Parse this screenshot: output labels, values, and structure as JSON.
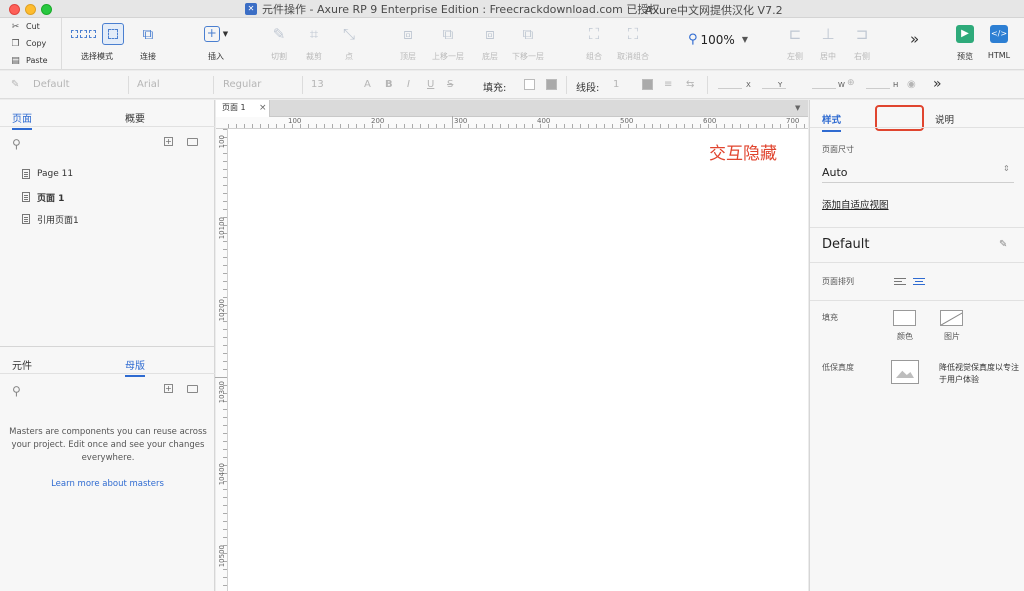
{
  "window": {
    "title": "元件操作 - Axure RP 9 Enterprise Edition : Freecrackdownload.com 已授权",
    "title_extra": "Axure中文网提供汉化 V7.2"
  },
  "clipboard": {
    "cut": "Cut",
    "copy": "Copy",
    "paste": "Paste"
  },
  "toolbar": {
    "select_mode": "选择模式",
    "connect": "连接",
    "insert": "插入",
    "cut": "切割",
    "crop": "裁剪",
    "point": "点",
    "top": "顶层",
    "up": "上移一层",
    "bottom": "底层",
    "down": "下移一层",
    "group": "组合",
    "ungroup": "取消组合",
    "zoom": "100%",
    "left": "左侧",
    "center": "居中",
    "right": "右侧",
    "more": "»",
    "preview": "预览",
    "html": "HTML"
  },
  "formatbar": {
    "style": "Default",
    "font": "Arial",
    "weight": "Regular",
    "size": "13",
    "font_a": "A",
    "bold": "B",
    "italic": "I",
    "underline": "U",
    "strike": "S",
    "fill": "填充:",
    "stroke": "线段:",
    "stroke_width": "1",
    "x_label": "X",
    "y_label": "Y",
    "w_label": "W",
    "h_label": "H",
    "more": "»"
  },
  "left_panel": {
    "top_tabs": [
      "页面",
      "概要"
    ],
    "pages": [
      {
        "name": "Page 11",
        "bold": false
      },
      {
        "name": "页面 1",
        "bold": true
      },
      {
        "name": "引用页面1",
        "bold": false
      }
    ],
    "bottom_tabs": [
      "元件",
      "母版"
    ],
    "masters_text": "Masters are components you can reuse across your project. Edit once and see your changes everywhere.",
    "masters_link": "Learn more about masters"
  },
  "canvas": {
    "doc_tab": "页面 1",
    "ruler_h": [
      "100",
      "200",
      "300",
      "400",
      "500",
      "600",
      "700"
    ],
    "ruler_v": [
      "100",
      "10100",
      "10200",
      "10300",
      "10400",
      "10500"
    ],
    "overlay_label": "交互隐藏"
  },
  "right_panel": {
    "tabs": [
      "样式",
      "说明"
    ],
    "page_size_label": "页面尺寸",
    "page_size_value": "Auto",
    "add_adaptive": "添加自适应视图",
    "style_name": "Default",
    "page_align_label": "页面排列",
    "fill_label": "填充",
    "fill_color": "颜色",
    "fill_image": "图片",
    "lofi_label": "低保真度",
    "lofi_desc": "降低视觉保真度以专注于用户体验"
  },
  "colors": {
    "accent": "#2f6bd1",
    "highlight": "#e0452f"
  }
}
